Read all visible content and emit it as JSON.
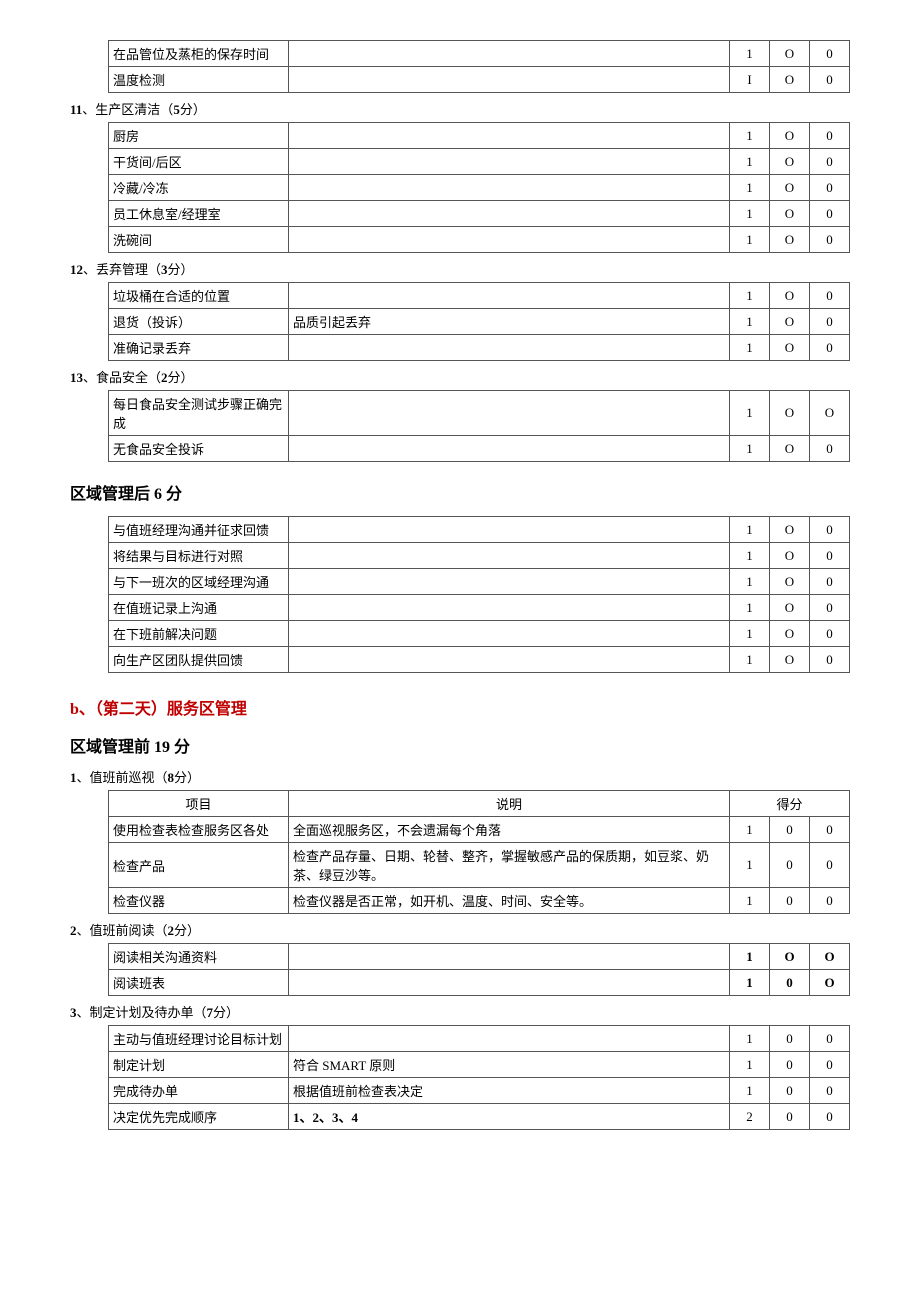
{
  "topTable": {
    "rows": [
      {
        "item": "在品管位及蒸柜的保存时间",
        "desc": "",
        "s1": "1",
        "s2": "O",
        "s3": "0"
      },
      {
        "item": "温度检测",
        "desc": "",
        "s1": "I",
        "s2": "O",
        "s3": "0"
      }
    ]
  },
  "sections": {
    "s11": {
      "num": "11",
      "title": "、生产区清洁（",
      "pts": "5",
      "tail": "分）",
      "rows": [
        {
          "item": "厨房",
          "desc": "",
          "s1": "1",
          "s2": "O",
          "s3": "0"
        },
        {
          "item": "干货间/后区",
          "desc": "",
          "s1": "1",
          "s2": "O",
          "s3": "0"
        },
        {
          "item": "冷藏/冷冻",
          "desc": "",
          "s1": "1",
          "s2": "O",
          "s3": "0"
        },
        {
          "item": "员工休息室/经理室",
          "desc": "",
          "s1": "1",
          "s2": "O",
          "s3": "0"
        },
        {
          "item": "洗碗间",
          "desc": "",
          "s1": "1",
          "s2": "O",
          "s3": "0"
        }
      ]
    },
    "s12": {
      "num": "12",
      "title": "、丢弃管理（",
      "pts": "3",
      "tail": "分）",
      "rows": [
        {
          "item": "垃圾桶在合适的位置",
          "desc": "",
          "s1": "1",
          "s2": "O",
          "s3": "0"
        },
        {
          "item": "退货（投诉）",
          "desc": "品质引起丢弃",
          "s1": "1",
          "s2": "O",
          "s3": "0"
        },
        {
          "item": "准确记录丢弃",
          "desc": "",
          "s1": "1",
          "s2": "O",
          "s3": "0"
        }
      ]
    },
    "s13": {
      "num": "13",
      "title": "、食品安全（",
      "pts": "2",
      "tail": "分）",
      "rows": [
        {
          "item": "每日食品安全测试步骤正确完成",
          "desc": "",
          "s1": "1",
          "s2": "O",
          "s3": "O"
        },
        {
          "item": "无食品安全投诉",
          "desc": "",
          "s1": "1",
          "s2": "O",
          "s3": "0"
        }
      ]
    }
  },
  "afterHeader": "区域管理后 6 分",
  "afterRows": [
    {
      "item": "与值班经理沟通并征求回馈",
      "desc": "",
      "s1": "1",
      "s2": "O",
      "s3": "0"
    },
    {
      "item": "将结果与目标进行对照",
      "desc": "",
      "s1": "1",
      "s2": "O",
      "s3": "0"
    },
    {
      "item": "与下一班次的区域经理沟通",
      "desc": "",
      "s1": "1",
      "s2": "O",
      "s3": "0"
    },
    {
      "item": "在值班记录上沟通",
      "desc": "",
      "s1": "1",
      "s2": "O",
      "s3": "0"
    },
    {
      "item": "在下班前解决问题",
      "desc": "",
      "s1": "1",
      "s2": "O",
      "s3": "0"
    },
    {
      "item": "向生产区团队提供回馈",
      "desc": "",
      "s1": "1",
      "s2": "O",
      "s3": "0"
    }
  ],
  "bHeader": "b、（第二天）服务区管理",
  "pre19Header": "区域管理前 19 分",
  "serviceSections": {
    "s1": {
      "num": "1",
      "title": "、值班前巡视（",
      "pts": "8",
      "tail": "分）",
      "header": {
        "c1": "项目",
        "c2": "说明",
        "c3": "得分"
      },
      "rows": [
        {
          "item": "使用检查表检查服务区各处",
          "desc": "全面巡视服务区，不会遗漏每个角落",
          "s1": "1",
          "s2": "0",
          "s3": "0"
        },
        {
          "item": "检查产品",
          "desc": "检查产品存量、日期、轮替、整齐，掌握敏感产品的保质期，如豆浆、奶茶、绿豆沙等。",
          "s1": "1",
          "s2": "0",
          "s3": "0"
        },
        {
          "item": "检查仪器",
          "desc": "检查仪器是否正常，如开机、温度、时间、安全等。",
          "s1": "1",
          "s2": "0",
          "s3": "0"
        }
      ]
    },
    "s2": {
      "num": "2",
      "title": "、值班前阅读（",
      "pts": "2",
      "tail": "分）",
      "rows": [
        {
          "item": "阅读相关沟通资料",
          "desc": "",
          "s1": "1",
          "s2": "O",
          "s3": "O",
          "bold": true
        },
        {
          "item": "阅读班表",
          "desc": "",
          "s1": "1",
          "s2": "0",
          "s3": "O",
          "bold": true
        }
      ]
    },
    "s3": {
      "num": "3",
      "title": "、制定计划及待办单（",
      "pts": "7",
      "tail": "分）",
      "rows": [
        {
          "item": "主动与值班经理讨论目标计划",
          "desc": "",
          "s1": "1",
          "s2": "0",
          "s3": "0"
        },
        {
          "item": "制定计划",
          "desc": "符合 SMART 原则",
          "s1": "1",
          "s2": "0",
          "s3": "0"
        },
        {
          "item": "完成待办单",
          "desc": "根据值班前检查表决定",
          "s1": "1",
          "s2": "0",
          "s3": "0"
        },
        {
          "item": "决定优先完成顺序",
          "desc": "1、2、3、4",
          "descBold": true,
          "s1": "2",
          "s2": "0",
          "s3": "0"
        }
      ]
    }
  }
}
